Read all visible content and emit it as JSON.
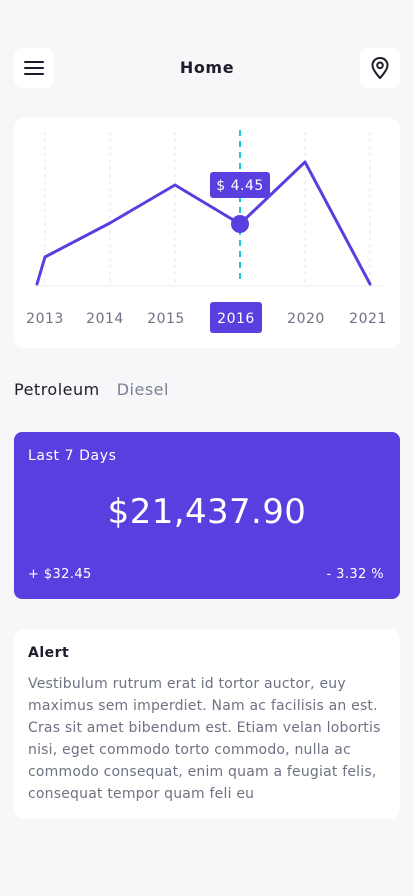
{
  "header": {
    "title": "Home",
    "menu_icon": "hamburger-menu-icon",
    "location_icon": "map-pin-icon"
  },
  "chart_data": {
    "type": "line",
    "categories": [
      "2013",
      "2014",
      "2015",
      "2016",
      "2020",
      "2021"
    ],
    "selected_category": "2016",
    "tooltip": "$ 4.45",
    "colors": {
      "line": "#5a3ee0",
      "highlight": "#1ec8d8",
      "grid": "#e4e4ec",
      "label": "#6e7282"
    }
  },
  "tabs": [
    {
      "label": "Petroleum",
      "active": true
    },
    {
      "label": "Diesel",
      "active": false
    }
  ],
  "summary": {
    "label": "Last 7 Days",
    "value": "$21,437.90",
    "change": "+ $32.45",
    "percent": "- 3.32 %",
    "color": "#5a3ee0"
  },
  "alert": {
    "title": "Alert",
    "body": "Vestibulum rutrum erat id tortor auctor, euy maximus sem imperdiet. Nam ac facilisis an est. Cras sit amet bibendum est. Etiam velan lobortis nisi, eget commodo torto commodo, nulla ac commodo consequat, enim quam a feugiat felis, consequat tempor quam feli eu"
  }
}
